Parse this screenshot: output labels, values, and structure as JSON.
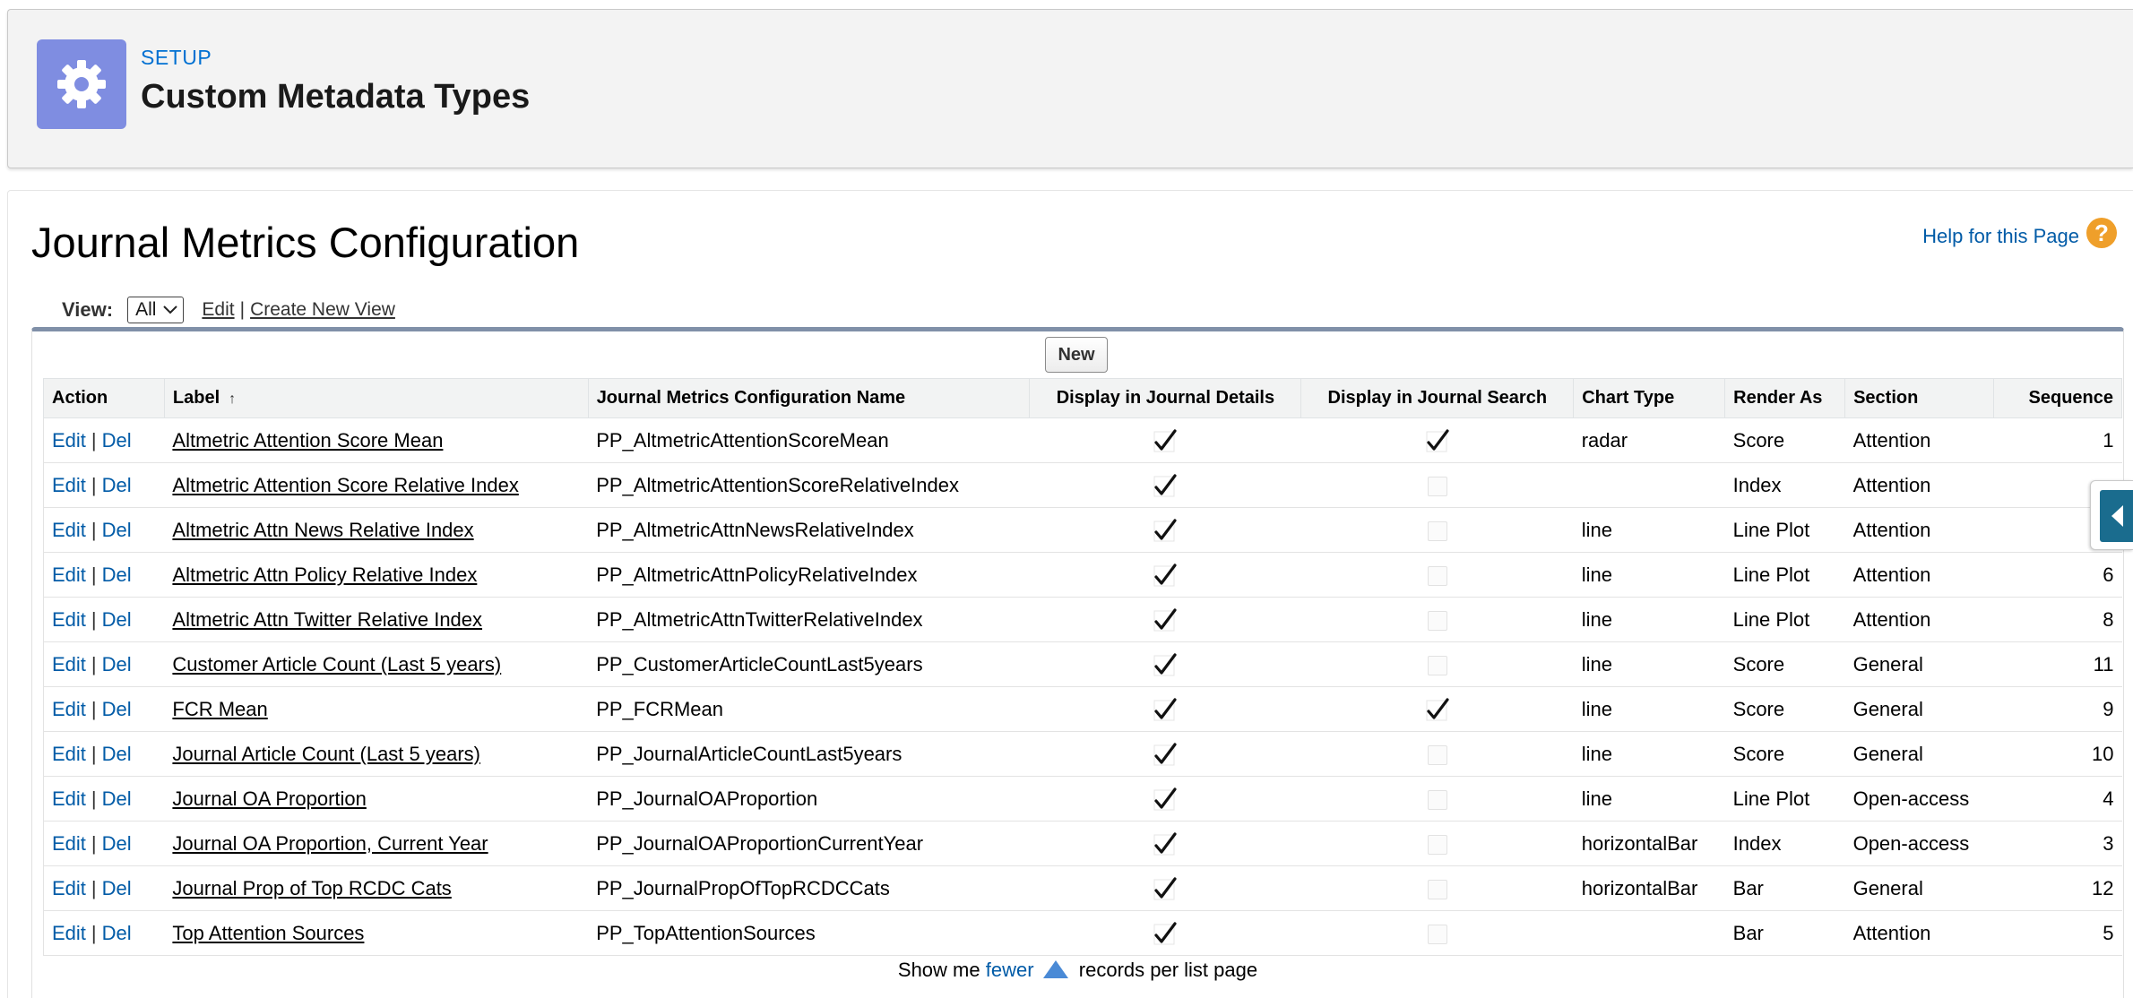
{
  "header": {
    "eyebrow": "SETUP",
    "title": "Custom Metadata Types",
    "icon": "gear-icon",
    "icon_color": "#7f8de1"
  },
  "page": {
    "title": "Journal Metrics Configuration",
    "help_label": "Help for this Page",
    "help_icon": "?"
  },
  "view": {
    "label": "View:",
    "selected": "All",
    "edit_label": "Edit",
    "separator": "|",
    "create_label": "Create New View"
  },
  "toolbar": {
    "new_label": "New"
  },
  "table": {
    "columns": {
      "action": "Action",
      "label": "Label",
      "name": "Journal Metrics Configuration Name",
      "details": "Display in Journal Details",
      "search": "Display in Journal Search",
      "chart_type": "Chart Type",
      "render_as": "Render As",
      "section": "Section",
      "sequence": "Sequence"
    },
    "edit_label": "Edit",
    "del_label": "Del",
    "separator": "|",
    "rows": [
      {
        "label": "Altmetric Attention Score Mean",
        "name": "PP_AltmetricAttentionScoreMean",
        "details": true,
        "search": true,
        "chart_type": "radar",
        "render_as": "Score",
        "section": "Attention",
        "sequence": "1"
      },
      {
        "label": "Altmetric Attention Score Relative Index",
        "name": "PP_AltmetricAttentionScoreRelativeIndex",
        "details": true,
        "search": false,
        "chart_type": "",
        "render_as": "Index",
        "section": "Attention",
        "sequence": ""
      },
      {
        "label": "Altmetric Attn News Relative Index",
        "name": "PP_AltmetricAttnNewsRelativeIndex",
        "details": true,
        "search": false,
        "chart_type": "line",
        "render_as": "Line Plot",
        "section": "Attention",
        "sequence": ""
      },
      {
        "label": "Altmetric Attn Policy Relative Index",
        "name": "PP_AltmetricAttnPolicyRelativeIndex",
        "details": true,
        "search": false,
        "chart_type": "line",
        "render_as": "Line Plot",
        "section": "Attention",
        "sequence": "6"
      },
      {
        "label": "Altmetric Attn Twitter Relative Index",
        "name": "PP_AltmetricAttnTwitterRelativeIndex",
        "details": true,
        "search": false,
        "chart_type": "line",
        "render_as": "Line Plot",
        "section": "Attention",
        "sequence": "8"
      },
      {
        "label": "Customer Article Count (Last 5 years)",
        "name": "PP_CustomerArticleCountLast5years",
        "details": true,
        "search": false,
        "chart_type": "line",
        "render_as": "Score",
        "section": "General",
        "sequence": "11"
      },
      {
        "label": "FCR Mean",
        "name": "PP_FCRMean",
        "details": true,
        "search": true,
        "chart_type": "line",
        "render_as": "Score",
        "section": "General",
        "sequence": "9"
      },
      {
        "label": "Journal Article Count (Last 5 years)",
        "name": "PP_JournalArticleCountLast5years",
        "details": true,
        "search": false,
        "chart_type": "line",
        "render_as": "Score",
        "section": "General",
        "sequence": "10"
      },
      {
        "label": "Journal OA Proportion",
        "name": "PP_JournalOAProportion",
        "details": true,
        "search": false,
        "chart_type": "line",
        "render_as": "Line Plot",
        "section": "Open-access",
        "sequence": "4"
      },
      {
        "label": "Journal OA Proportion, Current Year",
        "name": "PP_JournalOAProportionCurrentYear",
        "details": true,
        "search": false,
        "chart_type": "horizontalBar",
        "render_as": "Index",
        "section": "Open-access",
        "sequence": "3"
      },
      {
        "label": "Journal Prop of Top RCDC Cats",
        "name": "PP_JournalPropOfTopRCDCCats",
        "details": true,
        "search": false,
        "chart_type": "horizontalBar",
        "render_as": "Bar",
        "section": "General",
        "sequence": "12"
      },
      {
        "label": "Top Attention Sources",
        "name": "PP_TopAttentionSources",
        "details": true,
        "search": false,
        "chart_type": "",
        "render_as": "Bar",
        "section": "Attention",
        "sequence": "5"
      }
    ]
  },
  "pager": {
    "prefix": "Show me",
    "link": "fewer",
    "suffix": "records per list page"
  },
  "colors": {
    "link": "#015ba7",
    "accent_blue": "#0070d2",
    "help_orange": "#ef9f2a",
    "list_border": "#8090a8",
    "side_toggle": "#1a6c8e"
  }
}
